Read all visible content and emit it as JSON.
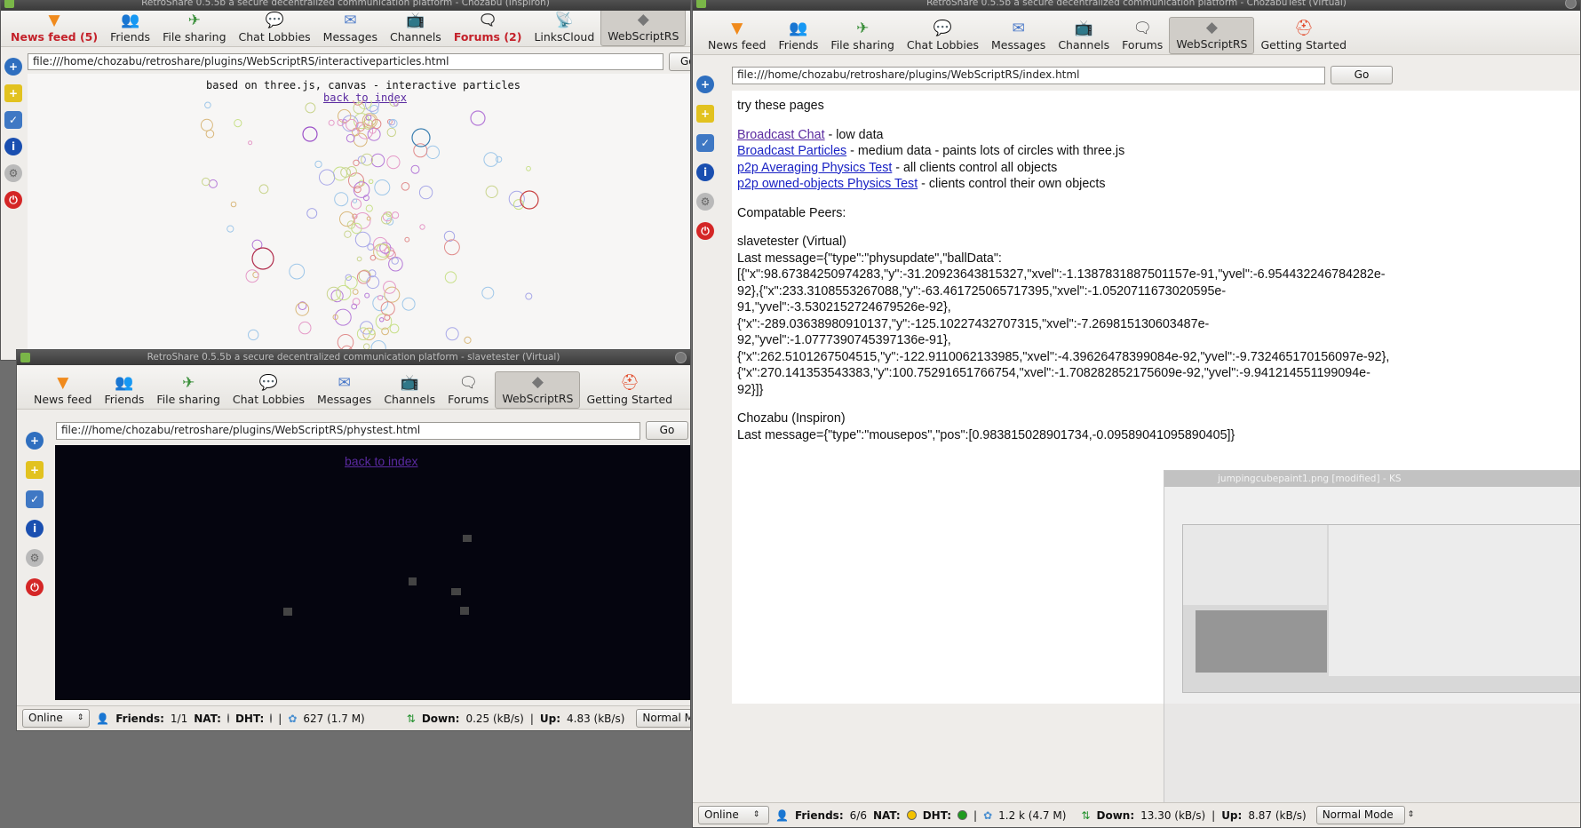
{
  "win_a": {
    "title": "RetroShare 0.5.5b a secure decentralized communication platform - Chozabu (Inspiron)",
    "toolbar": [
      {
        "label": "News feed (5)",
        "icon": "news-feed-icon",
        "alert": true
      },
      {
        "label": "Friends",
        "icon": "friends-icon"
      },
      {
        "label": "File sharing",
        "icon": "file-sharing-icon"
      },
      {
        "label": "Chat Lobbies",
        "icon": "chat-lobbies-icon"
      },
      {
        "label": "Messages",
        "icon": "messages-icon"
      },
      {
        "label": "Channels",
        "icon": "channels-icon"
      },
      {
        "label": "Forums (2)",
        "icon": "forums-icon",
        "alert": true
      },
      {
        "label": "LinksCloud",
        "icon": "linkscloud-icon"
      },
      {
        "label": "WebScriptRS",
        "icon": "webscriptrs-icon",
        "active": true
      }
    ],
    "url": "file:///home/chozabu/retroshare/plugins/WebScriptRS/interactiveparticles.html",
    "go_label": "Go",
    "page_text": "based on three.js, canvas - interactive particles",
    "back_link": "back to index"
  },
  "win_b": {
    "title": "RetroShare 0.5.5b a secure decentralized communication platform - slavetester (Virtual)",
    "toolbar": [
      {
        "label": "News feed",
        "icon": "news-feed-icon"
      },
      {
        "label": "Friends",
        "icon": "friends-icon"
      },
      {
        "label": "File sharing",
        "icon": "file-sharing-icon"
      },
      {
        "label": "Chat Lobbies",
        "icon": "chat-lobbies-icon"
      },
      {
        "label": "Messages",
        "icon": "messages-icon"
      },
      {
        "label": "Channels",
        "icon": "channels-icon"
      },
      {
        "label": "Forums",
        "icon": "forums-icon"
      },
      {
        "label": "WebScriptRS",
        "icon": "webscriptrs-icon",
        "active": true
      },
      {
        "label": "Getting Started",
        "icon": "getting-started-icon"
      }
    ],
    "url": "file:///home/chozabu/retroshare/plugins/WebScriptRS/phystest.html",
    "go_label": "Go",
    "back_link": "back to index",
    "status": {
      "online": "Online",
      "friends_label": "Friends:",
      "friends_value": "1/1",
      "nat_label": "NAT:",
      "dht_label": "DHT:",
      "peers": "627  (1.7 M)",
      "down_label": "Down:",
      "down_value": "0.25 (kB/s)",
      "up_label": "Up:",
      "up_value": "4.83 (kB/s)",
      "mode": "Normal Mode"
    }
  },
  "win_c": {
    "title": "RetroShare 0.5.5b a secure decentralized communication platform - ChozabuTest (Virtual)",
    "toolbar": [
      {
        "label": "News feed",
        "icon": "news-feed-icon"
      },
      {
        "label": "Friends",
        "icon": "friends-icon"
      },
      {
        "label": "File sharing",
        "icon": "file-sharing-icon"
      },
      {
        "label": "Chat Lobbies",
        "icon": "chat-lobbies-icon"
      },
      {
        "label": "Messages",
        "icon": "messages-icon"
      },
      {
        "label": "Channels",
        "icon": "channels-icon"
      },
      {
        "label": "Forums",
        "icon": "forums-icon"
      },
      {
        "label": "WebScriptRS",
        "icon": "webscriptrs-icon",
        "active": true
      },
      {
        "label": "Getting Started",
        "icon": "getting-started-icon"
      }
    ],
    "url": "file:///home/chozabu/retroshare/plugins/WebScriptRS/index.html",
    "go_label": "Go",
    "intro": "try these pages",
    "links": [
      {
        "text": "Broadcast Chat",
        "desc": " - low data"
      },
      {
        "text": "Broadcast Particles",
        "desc": " - medium data - paints lots of circles with three.js"
      },
      {
        "text": "p2p Averaging Physics Test",
        "desc": " - all clients control all objects"
      },
      {
        "text": "p2p owned-objects Physics Test",
        "desc": " - clients control their own objects"
      }
    ],
    "peers_heading": "Compatable Peers:",
    "peer1_name": "slavetester (Virtual)",
    "peer1_lines": [
      "Last message={\"type\":\"physupdate\",\"ballData\":",
      "[{\"x\":98.67384250974283,\"y\":-31.20923643815327,\"xvel\":-1.1387831887501157e-91,\"yvel\":-6.954432246784282e-",
      "92},{\"x\":233.3108553267088,\"y\":-63.461725065717395,\"xvel\":-1.0520711673020595e-",
      "91,\"yvel\":-3.5302152724679526e-92},",
      "{\"x\":-289.03638980910137,\"y\":-125.10227432707315,\"xvel\":-7.269815130603487e-",
      "92,\"yvel\":-1.0777390745397136e-91},",
      "{\"x\":262.5101267504515,\"y\":-122.9110062133985,\"xvel\":-4.39626478399084e-92,\"yvel\":-9.732465170156097e-92},",
      "{\"x\":270.141353543383,\"y\":100.75291651766754,\"xvel\":-1.708282852175609e-92,\"yvel\":-9.941214551199094e-",
      "92}]}"
    ],
    "peer2_name": "Chozabu (Inspiron)",
    "peer2_line": "Last message={\"type\":\"mousepos\",\"pos\":[0.983815028901734,-0.09589041095890405]}",
    "overlay_title": "jumpingcubepaint1.png [modified] - KS",
    "status": {
      "online": "Online",
      "friends_label": "Friends:",
      "friends_value": "6/6",
      "nat_label": "NAT:",
      "dht_label": "DHT:",
      "peers": "1.2 k (4.7 M)",
      "down_label": "Down:",
      "down_value": "13.30 (kB/s)",
      "up_label": "Up:",
      "up_value": "8.87 (kB/s)",
      "mode": "Normal Mode"
    }
  },
  "colors": {
    "nat": "#f3c200",
    "dht": "#1f9b1f",
    "link": "#1a22c4",
    "phys_bg": "#05050f"
  }
}
